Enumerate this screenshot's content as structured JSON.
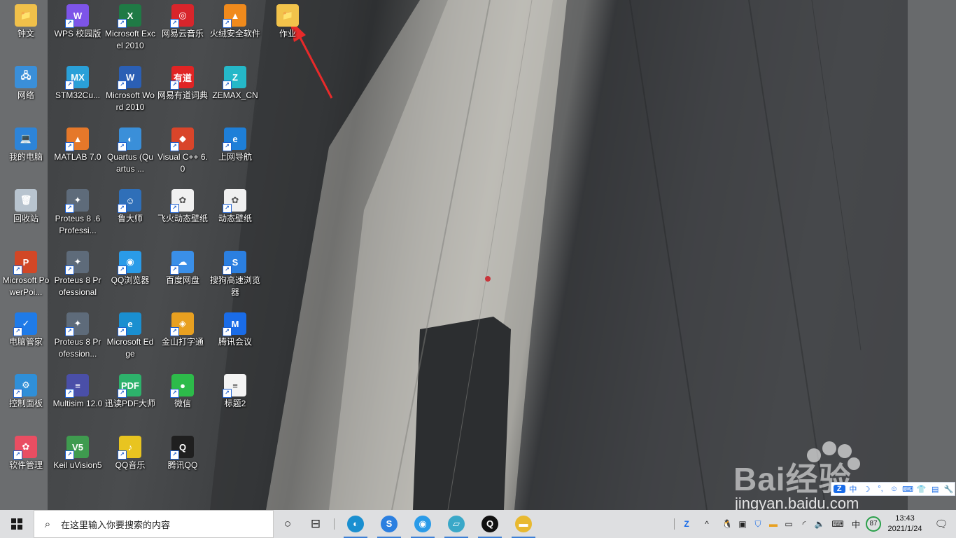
{
  "desktop": {
    "icons_col0": [
      {
        "label": "钟文",
        "icon": "folder-user-icon",
        "color": "#f0c04a",
        "glyph": "📁"
      },
      {
        "label": "网络",
        "icon": "network-icon",
        "color": "#3a8fd9",
        "glyph": "🖧"
      },
      {
        "label": "我的电脑",
        "icon": "computer-icon",
        "color": "#2d84d8",
        "glyph": "💻"
      },
      {
        "label": "回收站",
        "icon": "recycle-bin-icon",
        "color": "#b8c4cf",
        "glyph": "🗑"
      },
      {
        "label": "Microsoft PowerPoi...",
        "icon": "powerpoint-icon",
        "color": "#d24726",
        "glyph": "P"
      },
      {
        "label": "电脑管家",
        "icon": "pc-manager-icon",
        "color": "#1f7be8",
        "glyph": "✓"
      },
      {
        "label": "控制面板",
        "icon": "control-panel-icon",
        "color": "#2f8fd8",
        "glyph": "⚙"
      },
      {
        "label": "软件管理",
        "icon": "software-manager-icon",
        "color": "#e94e62",
        "glyph": "✿"
      }
    ],
    "icons_col1": [
      {
        "label": "WPS 校园版",
        "icon": "wps-icon",
        "color": "#7d54e8",
        "glyph": "W"
      },
      {
        "label": "STM32Cu...",
        "icon": "stm32cube-icon",
        "color": "#2aa0d8",
        "glyph": "MX"
      },
      {
        "label": "MATLAB 7.0",
        "icon": "matlab-icon",
        "color": "#e5782a",
        "glyph": "▲"
      },
      {
        "label": "Proteus 8 .6Professi...",
        "icon": "proteus-icon",
        "color": "#5e6b7a",
        "glyph": "✦"
      },
      {
        "label": "Proteus 8 Professional",
        "icon": "proteus-icon",
        "color": "#5e6b7a",
        "glyph": "✦"
      },
      {
        "label": "Proteus 8 Profession...",
        "icon": "proteus-icon",
        "color": "#5e6b7a",
        "glyph": "✦"
      },
      {
        "label": "Multisim 12.0",
        "icon": "multisim-icon",
        "color": "#4a4fa8",
        "glyph": "≡"
      },
      {
        "label": "Keil uVision5",
        "icon": "keil-icon",
        "color": "#3f9b4f",
        "glyph": "V5"
      }
    ],
    "icons_col2": [
      {
        "label": "Microsoft Excel 2010",
        "icon": "excel-icon",
        "color": "#1f7a45",
        "glyph": "X"
      },
      {
        "label": "Microsoft Word 2010",
        "icon": "word-icon",
        "color": "#2b5fb4",
        "glyph": "W"
      },
      {
        "label": "Quartus (Quartus ...",
        "icon": "quartus-icon",
        "color": "#3a8fd9",
        "glyph": "◐"
      },
      {
        "label": "鲁大师",
        "icon": "ludashi-icon",
        "color": "#2f6fb8",
        "glyph": "☺"
      },
      {
        "label": "QQ浏览器",
        "icon": "qq-browser-icon",
        "color": "#2a9be8",
        "glyph": "◉"
      },
      {
        "label": "Microsoft Edge",
        "icon": "edge-icon",
        "color": "#1a8fd0",
        "glyph": "e"
      },
      {
        "label": "迅读PDF大师",
        "icon": "pdf-reader-icon",
        "color": "#2db26b",
        "glyph": "PDF"
      },
      {
        "label": "QQ音乐",
        "icon": "qq-music-icon",
        "color": "#e8c420",
        "glyph": "♪"
      }
    ],
    "icons_col3": [
      {
        "label": "网易云音乐",
        "icon": "netease-music-icon",
        "color": "#d8252b",
        "glyph": "◎"
      },
      {
        "label": "网易有道词典",
        "icon": "youdao-icon",
        "color": "#e02424",
        "glyph": "有道"
      },
      {
        "label": "Visual C++ 6.0",
        "icon": "visual-cpp-icon",
        "color": "#d9452a",
        "glyph": "◆"
      },
      {
        "label": "飞火动态壁纸",
        "icon": "wallpaper-app-icon",
        "color": "#f0f0f0",
        "glyph": "✿"
      },
      {
        "label": "百度网盘",
        "icon": "baidu-netdisk-icon",
        "color": "#3a8fe8",
        "glyph": "☁"
      },
      {
        "label": "金山打字通",
        "icon": "typing-icon",
        "color": "#e8a020",
        "glyph": "◈"
      },
      {
        "label": "微信",
        "icon": "wechat-icon",
        "color": "#2dbb4a",
        "glyph": "●"
      },
      {
        "label": "腾讯QQ",
        "icon": "qq-icon",
        "color": "#1f1f1f",
        "glyph": "Q"
      }
    ],
    "icons_col4": [
      {
        "label": "火绒安全软件",
        "icon": "huorong-icon",
        "color": "#f08a1c",
        "glyph": "▲"
      },
      {
        "label": "ZEMAX_CN",
        "icon": "zemax-icon",
        "color": "#25b8c8",
        "glyph": "Z"
      },
      {
        "label": "上网导航",
        "icon": "ie-icon",
        "color": "#1e7fd8",
        "glyph": "e"
      },
      {
        "label": "动态壁纸",
        "icon": "wallpaper-app-icon",
        "color": "#f0f0f0",
        "glyph": "✿"
      },
      {
        "label": "搜狗高速浏览器",
        "icon": "sogou-browser-icon",
        "color": "#2b7fe0",
        "glyph": "S"
      },
      {
        "label": "腾讯会议",
        "icon": "tencent-meeting-icon",
        "color": "#1a6ce8",
        "glyph": "M"
      },
      {
        "label": "标题2",
        "icon": "document-icon",
        "color": "#f4f4f4",
        "glyph": "≡"
      }
    ],
    "icons_col5": [
      {
        "label": "作业",
        "icon": "folder-icon",
        "color": "#f2c34b",
        "glyph": "📁"
      }
    ]
  },
  "watermark": {
    "brand": "Bai经验",
    "url": "jingyan.baidu.com"
  },
  "ime_toolbar": {
    "items": [
      "中",
      "☽",
      "°,",
      "☺",
      "⌨",
      "👕",
      "▤",
      "🔧"
    ]
  },
  "taskbar": {
    "search_placeholder": "在这里输入你要搜索的内容",
    "pinned": [
      {
        "icon": "edge-icon",
        "glyph": "◐",
        "color": "#1a8fd0"
      },
      {
        "icon": "sogou-browser-icon",
        "glyph": "S",
        "color": "#2b7fe0"
      },
      {
        "icon": "qq-browser-icon",
        "glyph": "◉",
        "color": "#2a9be8"
      },
      {
        "icon": "notes-app-icon",
        "glyph": "▱",
        "color": "#3aa8c8"
      },
      {
        "icon": "qq-icon",
        "glyph": "Q",
        "color": "#111111"
      },
      {
        "icon": "file-explorer-icon",
        "glyph": "▬",
        "color": "#e8b930"
      }
    ],
    "tray": {
      "battery_level": "87",
      "ime_label": "中",
      "time": "13:43",
      "date": "2021/1/24"
    }
  }
}
